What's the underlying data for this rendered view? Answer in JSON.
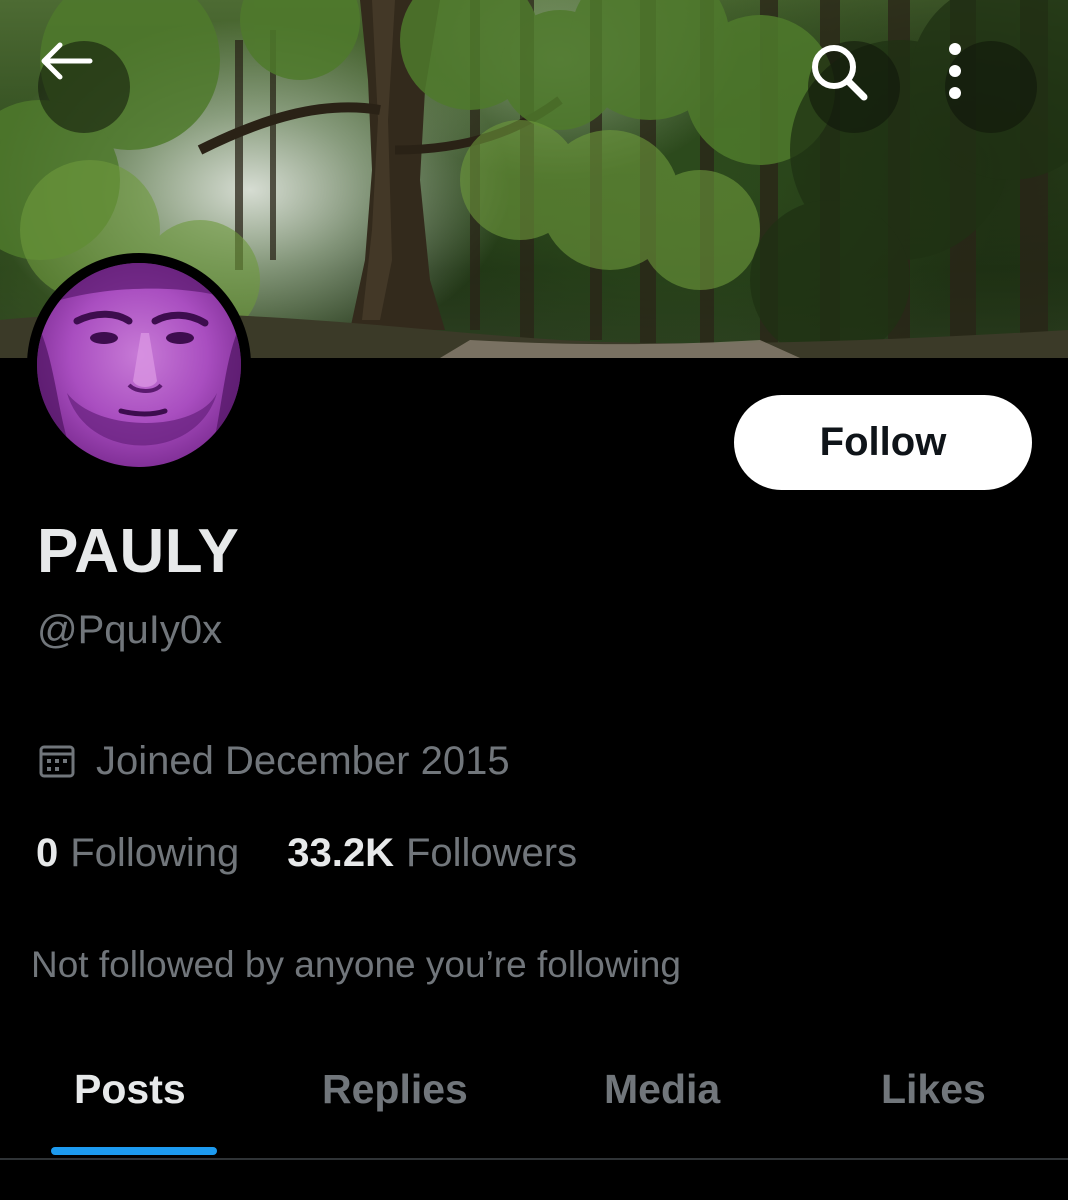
{
  "header": {
    "back_icon": "arrow-left-icon",
    "search_icon": "search-icon",
    "more_icon": "more-vertical-icon"
  },
  "profile": {
    "display_name": "PAULY",
    "handle": "@PquIy0x",
    "joined": "Joined December 2015",
    "joined_icon": "calendar-icon",
    "follow_label": "Follow",
    "following_count": "0",
    "following_label": "Following",
    "followers_count": "33.2K",
    "followers_label": "Followers",
    "not_followed_text": "Not followed by anyone you’re following"
  },
  "tabs": [
    {
      "label": "Posts",
      "active": true
    },
    {
      "label": "Replies",
      "active": false
    },
    {
      "label": "Media",
      "active": false
    },
    {
      "label": "Likes",
      "active": false
    }
  ],
  "colors": {
    "background": "#000000",
    "primary_text": "#e7e9ea",
    "secondary_text": "#71767b",
    "accent": "#1d9bf0",
    "avatar_tint": "#a94ec0"
  }
}
